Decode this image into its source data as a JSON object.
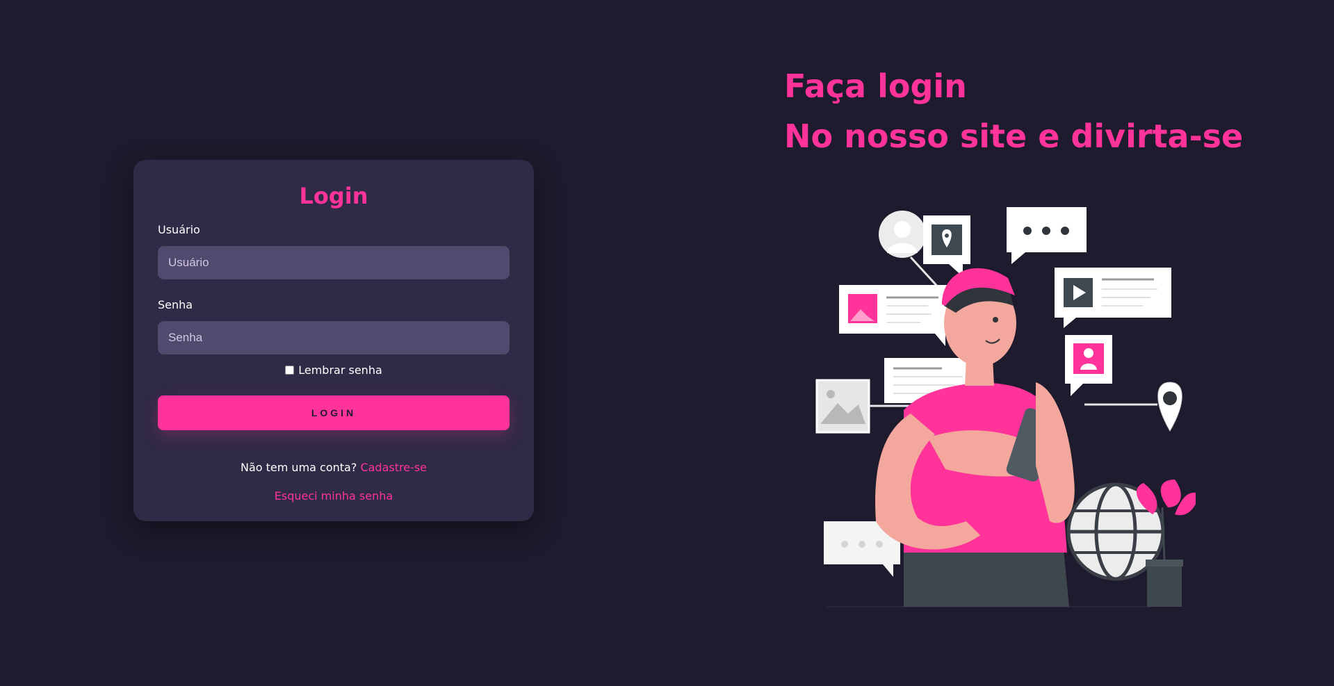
{
  "headline": {
    "line1": "Faça login",
    "line2": "No nosso site e divirta-se"
  },
  "login_card": {
    "title": "Login",
    "username": {
      "label": "Usuário",
      "placeholder": "Usuário",
      "value": ""
    },
    "password": {
      "label": "Senha",
      "placeholder": "Senha",
      "value": ""
    },
    "remember_label": "Lembrar senha",
    "remember_checked": false,
    "submit_label": "LOGIN",
    "signup_prompt": "Não tem uma conta?",
    "signup_link": "Cadastre-se",
    "forgot_link": "Esqueci minha senha"
  },
  "colors": {
    "background": "#1f1b2e",
    "card": "#2f2a45",
    "input": "#524a6e",
    "accent": "#ff3399"
  },
  "illustration": {
    "icons": [
      "person-with-phone",
      "chat-bubble-icon",
      "location-pin-icon",
      "image-icon",
      "play-icon",
      "user-icon",
      "globe-icon",
      "plant-icon"
    ]
  }
}
